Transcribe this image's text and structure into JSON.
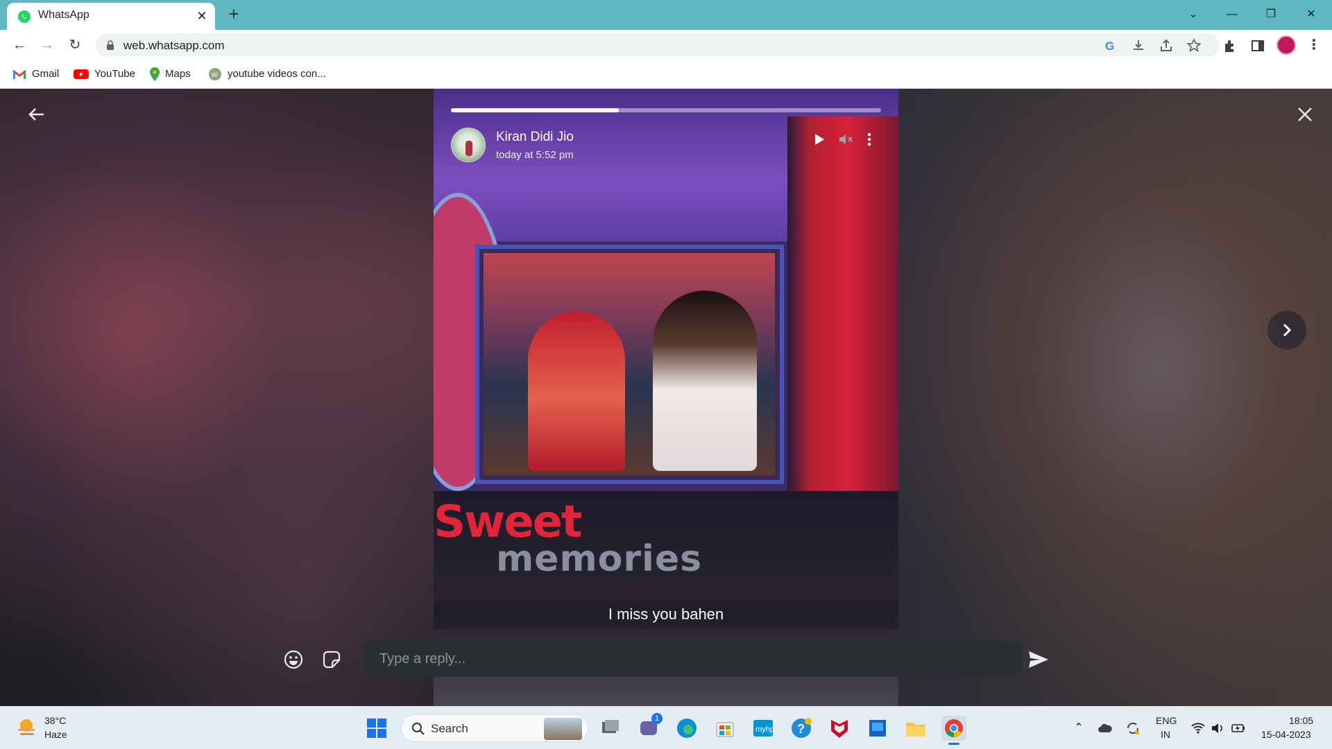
{
  "browser": {
    "tab_title": "WhatsApp",
    "url": "web.whatsapp.com",
    "bookmarks": [
      {
        "label": "Gmail",
        "icon": "gmail-icon"
      },
      {
        "label": "YouTube",
        "icon": "youtube-icon"
      },
      {
        "label": "Maps",
        "icon": "maps-icon"
      },
      {
        "label": "youtube videos con...",
        "icon": "site-icon"
      }
    ]
  },
  "status": {
    "contact_name": "Kiran Didi Jio",
    "posted_time": "today at 5:52 pm",
    "progress": 0.39,
    "caption": "I miss you bahen",
    "photo_text_big": "Sweet",
    "photo_text_second": "memories",
    "reply_placeholder": "Type a reply..."
  },
  "taskbar": {
    "weather_temp": "38°C",
    "weather_desc": "Haze",
    "search_label": "Search",
    "teams_badge": "1",
    "language_line1": "ENG",
    "language_line2": "IN",
    "time": "18:05",
    "date": "15-04-2023"
  },
  "colors": {
    "chrome_accent": "#5fb7c2",
    "whatsapp_green": "#25d366",
    "reply_bg": "#2a2f32"
  }
}
